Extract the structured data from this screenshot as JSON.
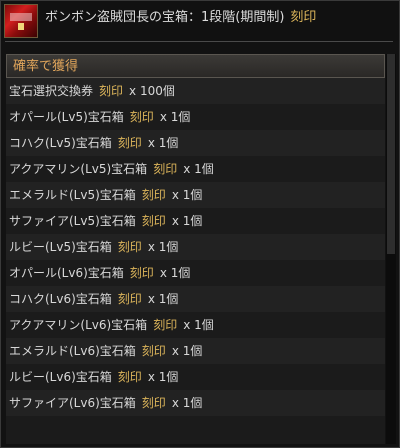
{
  "header": {
    "title": "ボンボン盗賊団長の宝箱：1段階(期間制)",
    "bind_label": "刻印",
    "icon": "red-treasure-chest-icon"
  },
  "section": {
    "label": "確率で獲得"
  },
  "items": [
    {
      "name": "宝石選択交換券",
      "bind": "刻印",
      "qty": "x 100個"
    },
    {
      "name": "オパール(Lv5)宝石箱",
      "bind": "刻印",
      "qty": "x 1個"
    },
    {
      "name": "コハク(Lv5)宝石箱",
      "bind": "刻印",
      "qty": "x 1個"
    },
    {
      "name": "アクアマリン(Lv5)宝石箱",
      "bind": "刻印",
      "qty": "x 1個"
    },
    {
      "name": "エメラルド(Lv5)宝石箱",
      "bind": "刻印",
      "qty": "x 1個"
    },
    {
      "name": "サファイア(Lv5)宝石箱",
      "bind": "刻印",
      "qty": "x 1個"
    },
    {
      "name": "ルビー(Lv5)宝石箱",
      "bind": "刻印",
      "qty": "x 1個"
    },
    {
      "name": "オパール(Lv6)宝石箱",
      "bind": "刻印",
      "qty": "x 1個"
    },
    {
      "name": "コハク(Lv6)宝石箱",
      "bind": "刻印",
      "qty": "x 1個"
    },
    {
      "name": "アクアマリン(Lv6)宝石箱",
      "bind": "刻印",
      "qty": "x 1個"
    },
    {
      "name": "エメラルド(Lv6)宝石箱",
      "bind": "刻印",
      "qty": "x 1個"
    },
    {
      "name": "ルビー(Lv6)宝石箱",
      "bind": "刻印",
      "qty": "x 1個"
    },
    {
      "name": "サファイア(Lv6)宝石箱",
      "bind": "刻印",
      "qty": "x 1個"
    }
  ],
  "colors": {
    "bind_text": "#dbb45a",
    "section_text": "#e0a55b",
    "item_text": "#d8d8d8"
  }
}
